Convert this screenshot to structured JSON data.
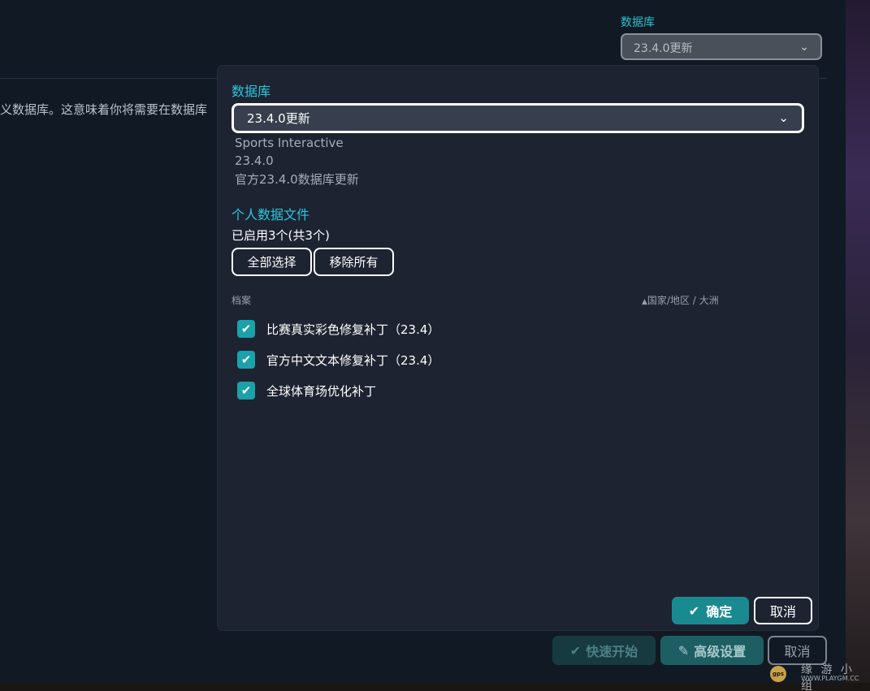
{
  "background": {
    "description_text": "义数据库。这意味着你将需要在数据库",
    "database_label": "数据库",
    "database_selected": "23.4.0更新",
    "buttons": {
      "quick_start": "快速开始",
      "advanced": "高级设置",
      "cancel": "取消"
    },
    "watermark": {
      "badge": "gps",
      "title": "缘 游 小 组",
      "url": "WWW.PLAYGM.CC"
    }
  },
  "modal": {
    "database_label": "数据库",
    "database_selected": "23.4.0更新",
    "database_info": {
      "author": "Sports Interactive",
      "version": "23.4.0",
      "description": "官方23.4.0数据库更新"
    },
    "files_label": "个人数据文件",
    "files_count": "已启用3个(共3个)",
    "select_all": "全部选择",
    "remove_all": "移除所有",
    "columns": {
      "archive": "档案",
      "country": "国家/地区 / 大洲"
    },
    "items": [
      {
        "label": "比赛真实彩色修复补丁（23.4）",
        "checked": true
      },
      {
        "label": "官方中文文本修复补丁（23.4）",
        "checked": true
      },
      {
        "label": "全球体育场优化补丁",
        "checked": true
      }
    ],
    "ok": "确定",
    "cancel": "取消"
  },
  "colors": {
    "accent": "#27c9dc",
    "button_primary": "#1a8a91",
    "checkbox": "#1aa1a9",
    "modal_bg": "#1e2332"
  }
}
